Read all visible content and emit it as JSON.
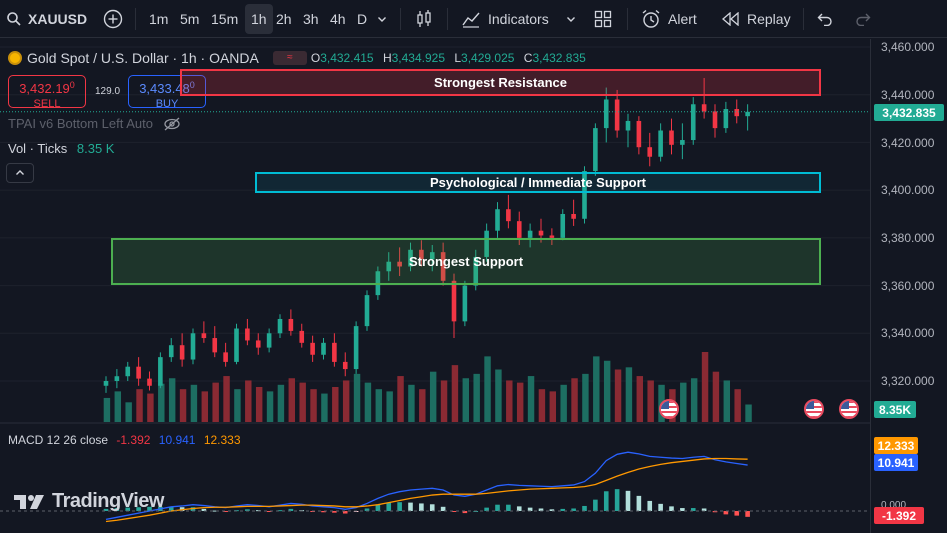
{
  "toolbar": {
    "symbol": "XAUUSD",
    "timeframes": [
      "1m",
      "5m",
      "15m",
      "1h",
      "2h",
      "3h",
      "4h",
      "D"
    ],
    "active_timeframe": "1h",
    "indicators_label": "Indicators",
    "alert_label": "Alert",
    "replay_label": "Replay"
  },
  "legend": {
    "title": "Gold Spot / U.S. Dollar · 1h · OANDA",
    "o_label": "O",
    "o_value": "3,432.415",
    "h_label": "H",
    "h_value": "3,434.925",
    "l_label": "L",
    "l_value": "3,429.025",
    "c_label": "C",
    "c_value": "3,432.835"
  },
  "trade": {
    "sell_price": "3,432.19",
    "sell_sup": "0",
    "sell_label": "SELL",
    "spread": "129.0",
    "buy_price": "3,433.48",
    "buy_sup": "0",
    "buy_label": "BUY"
  },
  "indicator_line": "TPAI v6 Bottom Left Auto",
  "volume_legend": {
    "label": "Vol · Ticks",
    "value": "8.35 K"
  },
  "zones": {
    "resistance": "Strongest Resistance",
    "psych": "Psychological / Immediate Support",
    "support": "Strongest Support"
  },
  "price_axis": {
    "labels": [
      "3,460.000",
      "3,440.000",
      "3,420.000",
      "3,400.000",
      "3,380.000",
      "3,360.000",
      "3,340.000",
      "3,320.000"
    ],
    "current_price": "3,432.835",
    "volume_tag": "8.35K",
    "macd_signal_tag": "12.333",
    "macd_line_tag": "10.941",
    "macd_hist_tag": "-1.392",
    "zero_label": "0.000"
  },
  "macd_legend": {
    "label": "MACD 12 26 close",
    "hist": "-1.392",
    "macd": "10.941",
    "signal": "12.333"
  },
  "watermark": "TradingView",
  "colors": {
    "bull": "#22ab94",
    "bear": "#f23645",
    "macd": "#2962ff",
    "signal": "#ff9800",
    "resistance_border": "#f23645",
    "psych_border": "#00bcd4",
    "support_border": "#4caf50"
  },
  "chart_data": {
    "type": "candlestick",
    "y_range": [
      3310,
      3465
    ],
    "candles": [
      [
        3318,
        3322,
        3315,
        3320
      ],
      [
        3320,
        3325,
        3317,
        3322
      ],
      [
        3322,
        3328,
        3320,
        3326
      ],
      [
        3326,
        3330,
        3318,
        3321
      ],
      [
        3321,
        3324,
        3316,
        3318
      ],
      [
        3318,
        3332,
        3317,
        3330
      ],
      [
        3330,
        3338,
        3328,
        3335
      ],
      [
        3335,
        3340,
        3326,
        3329
      ],
      [
        3329,
        3342,
        3327,
        3340
      ],
      [
        3340,
        3345,
        3336,
        3338
      ],
      [
        3338,
        3343,
        3330,
        3332
      ],
      [
        3332,
        3336,
        3326,
        3328
      ],
      [
        3328,
        3344,
        3327,
        3342
      ],
      [
        3342,
        3346,
        3335,
        3337
      ],
      [
        3337,
        3340,
        3331,
        3334
      ],
      [
        3334,
        3342,
        3332,
        3340
      ],
      [
        3340,
        3348,
        3338,
        3346
      ],
      [
        3346,
        3350,
        3339,
        3341
      ],
      [
        3341,
        3344,
        3334,
        3336
      ],
      [
        3336,
        3339,
        3328,
        3331
      ],
      [
        3331,
        3338,
        3329,
        3336
      ],
      [
        3336,
        3340,
        3326,
        3328
      ],
      [
        3328,
        3332,
        3322,
        3325
      ],
      [
        3325,
        3345,
        3323,
        3343
      ],
      [
        3343,
        3358,
        3341,
        3356
      ],
      [
        3356,
        3368,
        3354,
        3366
      ],
      [
        3366,
        3374,
        3362,
        3370
      ],
      [
        3370,
        3376,
        3364,
        3368
      ],
      [
        3368,
        3378,
        3366,
        3375
      ],
      [
        3375,
        3379,
        3368,
        3371
      ],
      [
        3371,
        3377,
        3366,
        3374
      ],
      [
        3374,
        3378,
        3360,
        3362
      ],
      [
        3362,
        3365,
        3338,
        3345
      ],
      [
        3345,
        3362,
        3343,
        3360
      ],
      [
        3360,
        3375,
        3358,
        3372
      ],
      [
        3372,
        3386,
        3370,
        3383
      ],
      [
        3383,
        3395,
        3380,
        3392
      ],
      [
        3392,
        3398,
        3384,
        3387
      ],
      [
        3387,
        3391,
        3377,
        3380
      ],
      [
        3380,
        3386,
        3376,
        3383
      ],
      [
        3383,
        3388,
        3378,
        3381
      ],
      [
        3381,
        3384,
        3377,
        3380
      ],
      [
        3380,
        3392,
        3379,
        3390
      ],
      [
        3390,
        3396,
        3385,
        3388
      ],
      [
        3388,
        3410,
        3386,
        3408
      ],
      [
        3408,
        3428,
        3406,
        3426
      ],
      [
        3426,
        3443,
        3420,
        3438
      ],
      [
        3438,
        3442,
        3422,
        3425
      ],
      [
        3425,
        3432,
        3418,
        3429
      ],
      [
        3429,
        3431,
        3415,
        3418
      ],
      [
        3418,
        3424,
        3410,
        3414
      ],
      [
        3414,
        3428,
        3412,
        3425
      ],
      [
        3425,
        3430,
        3415,
        3419
      ],
      [
        3419,
        3428,
        3413,
        3421
      ],
      [
        3421,
        3439,
        3419,
        3436
      ],
      [
        3436,
        3447,
        3430,
        3433
      ],
      [
        3433,
        3436,
        3422,
        3426
      ],
      [
        3426,
        3437,
        3424,
        3434
      ],
      [
        3434,
        3438,
        3428,
        3431
      ],
      [
        3431,
        3436,
        3425,
        3432.835
      ]
    ],
    "volumes": [
      22,
      28,
      18,
      30,
      26,
      35,
      40,
      30,
      34,
      28,
      36,
      42,
      30,
      38,
      32,
      28,
      34,
      40,
      36,
      30,
      26,
      32,
      38,
      44,
      36,
      30,
      28,
      42,
      34,
      30,
      46,
      38,
      52,
      40,
      44,
      60,
      48,
      38,
      36,
      42,
      30,
      28,
      34,
      40,
      44,
      60,
      56,
      48,
      50,
      42,
      38,
      34,
      30,
      36,
      40,
      64,
      46,
      38,
      30,
      16
    ],
    "macd": [
      -2,
      -1.5,
      -1,
      -0.5,
      0,
      0.5,
      1,
      1.2,
      1.5,
      1.3,
      1,
      0.8,
      1.2,
      1.5,
      1.3,
      1,
      1.4,
      1.8,
      1.6,
      1.2,
      1,
      0.8,
      0.4,
      0.8,
      1.8,
      3,
      4,
      4.6,
      5,
      5.2,
      5.4,
      5,
      3.8,
      3.5,
      4,
      5,
      6,
      6.3,
      6.1,
      6,
      5.9,
      5.8,
      6,
      6.2,
      7,
      9,
      12,
      13.5,
      14,
      13.6,
      13,
      12.8,
      12.6,
      12.5,
      12.8,
      13,
      12.2,
      11.7,
      11.3,
      10.941
    ],
    "signal": [
      -2.5,
      -2.2,
      -1.8,
      -1.4,
      -1,
      -0.5,
      0,
      0.3,
      0.6,
      0.8,
      0.9,
      0.9,
      1,
      1.1,
      1.1,
      1.1,
      1.2,
      1.3,
      1.4,
      1.4,
      1.3,
      1.2,
      1,
      1,
      1.2,
      1.5,
      2,
      2.5,
      3,
      3.4,
      3.8,
      4,
      4,
      4,
      4,
      4.2,
      4.5,
      4.8,
      5,
      5.2,
      5.3,
      5.4,
      5.5,
      5.6,
      5.8,
      6.3,
      7.3,
      8.3,
      9.2,
      10,
      10.6,
      11.1,
      11.5,
      11.8,
      12.1,
      12.4,
      12.5,
      12.5,
      12.4,
      12.333
    ]
  }
}
